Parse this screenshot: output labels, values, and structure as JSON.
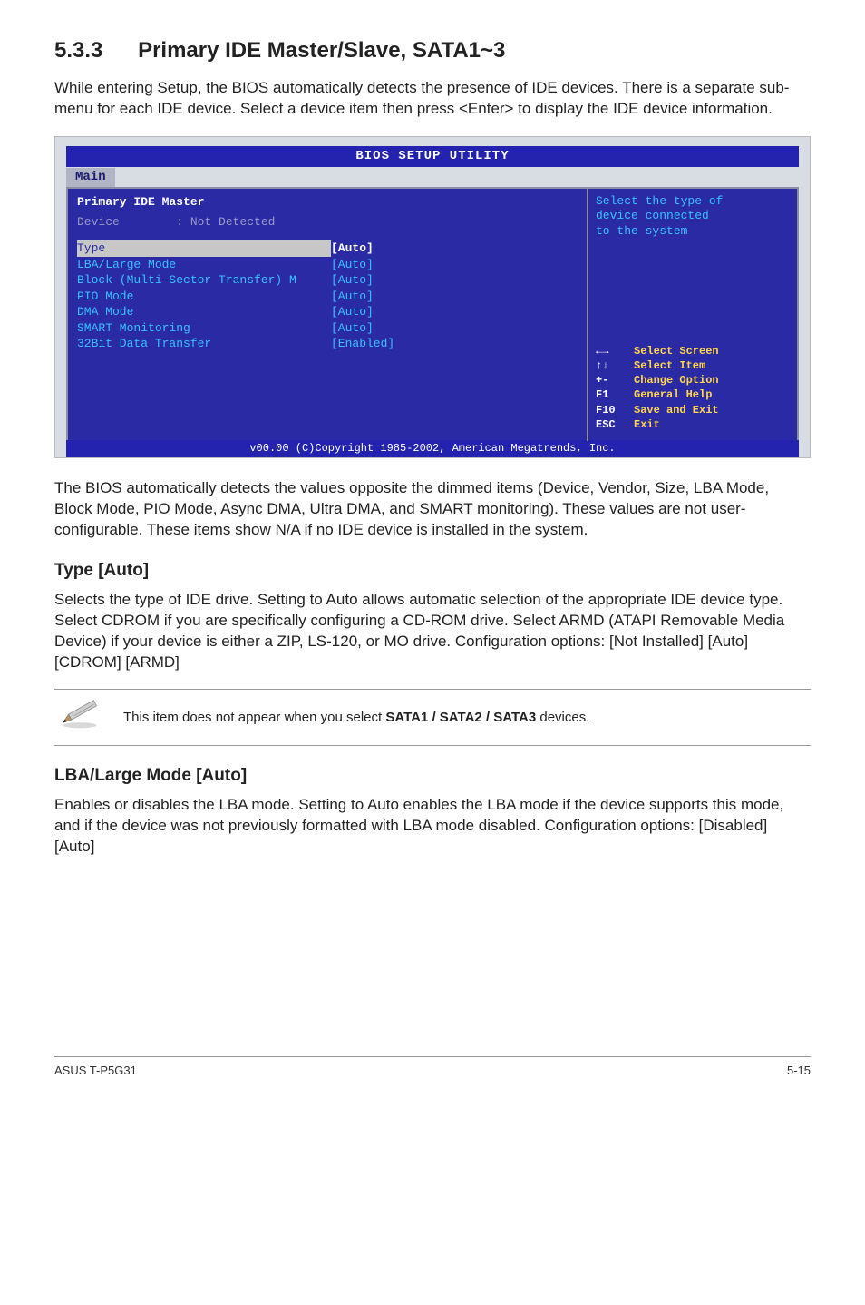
{
  "section": {
    "number": "5.3.3",
    "title": "Primary IDE Master/Slave, SATA1~3"
  },
  "intro": "While entering Setup, the BIOS automatically detects the presence of IDE devices. There is a separate sub-menu for each IDE device. Select a device item then press <Enter> to display the IDE device information.",
  "bios": {
    "title": "BIOS SETUP UTILITY",
    "tab": "Main",
    "panel_title": "Primary IDE Master",
    "device_label": "Device",
    "device_value": ": Not Detected",
    "rows": [
      {
        "label": "Type",
        "value": "[Auto]",
        "selected": true
      },
      {
        "label": "LBA/Large Mode",
        "value": "[Auto]",
        "selected": false
      },
      {
        "label": "Block (Multi-Sector Transfer) M",
        "value": "[Auto]",
        "selected": false
      },
      {
        "label": "PIO Mode",
        "value": "[Auto]",
        "selected": false
      },
      {
        "label": "DMA Mode",
        "value": "[Auto]",
        "selected": false
      },
      {
        "label": "SMART Monitoring",
        "value": "[Auto]",
        "selected": false
      },
      {
        "label": "32Bit Data Transfer",
        "value": "[Enabled]",
        "selected": false
      }
    ],
    "help_top": [
      "Select the type of",
      "device connected",
      "to the system"
    ],
    "help_keys": [
      {
        "k": "←→",
        "t": "Select Screen"
      },
      {
        "k": "↑↓",
        "t": "Select Item"
      },
      {
        "k": "+-",
        "t": "Change Option"
      },
      {
        "k": "F1",
        "t": "General Help"
      },
      {
        "k": "F10",
        "t": "Save and Exit"
      },
      {
        "k": "ESC",
        "t": "Exit"
      }
    ],
    "footer": "v00.00 (C)Copyright 1985-2002, American Megatrends, Inc."
  },
  "after_bios": "The BIOS automatically detects the values opposite the dimmed items (Device, Vendor, Size, LBA Mode, Block Mode, PIO Mode, Async DMA, Ultra DMA, and SMART monitoring). These values are not user-configurable. These items show N/A if no IDE device is installed in the system.",
  "type_heading": "Type [Auto]",
  "type_body": "Selects the type of IDE drive. Setting to Auto allows automatic selection of the appropriate IDE device type. Select CDROM if you are specifically configuring a CD-ROM drive. Select ARMD (ATAPI Removable Media Device) if your device is either a ZIP, LS-120, or MO drive. Configuration options: [Not Installed] [Auto] [CDROM] [ARMD]",
  "note_prefix": "This item does not appear when you select ",
  "note_bold": "SATA1 / SATA2 / SATA3",
  "note_suffix": " devices.",
  "lba_heading": "LBA/Large Mode [Auto]",
  "lba_body": "Enables or disables the LBA mode. Setting to Auto enables the LBA mode if the device supports this mode, and if the device was not previously formatted with LBA mode disabled. Configuration options: [Disabled] [Auto]",
  "footer": {
    "left": "ASUS T-P5G31",
    "right": "5-15"
  }
}
